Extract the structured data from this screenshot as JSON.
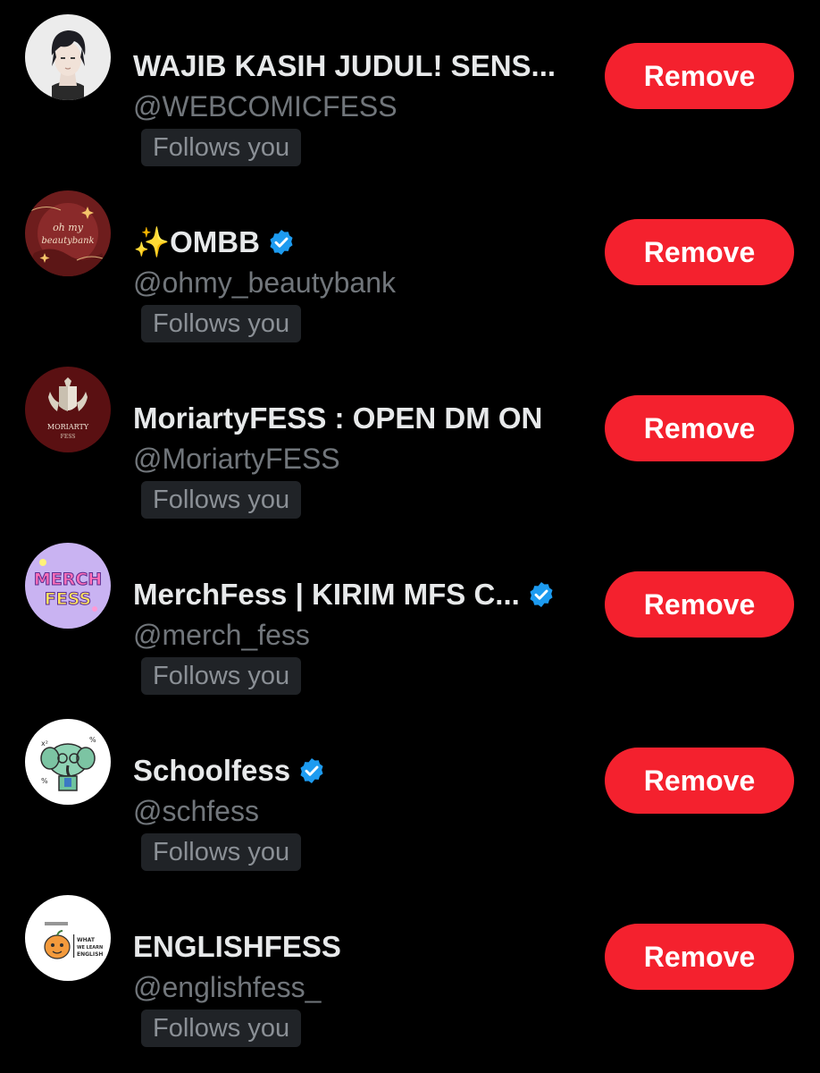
{
  "colors": {
    "background": "#000000",
    "remove_button": "#f4212e",
    "verified_badge": "#1d9bf0",
    "handle_text": "#71767b",
    "follows_chip": "#202327"
  },
  "followers": [
    {
      "name": "WAJIB KASIH JUDUL! SENS...",
      "handle": "@WEBCOMICFESS",
      "follows_label": "Follows you",
      "verified": false,
      "remove_label": "Remove",
      "avatar_icon": "anime-boy-avatar-icon"
    },
    {
      "name": "✨OMBB",
      "handle": "@ohmy_beautybank",
      "follows_label": "Follows you",
      "verified": true,
      "remove_label": "Remove",
      "avatar_icon": "oh-my-beautybank-logo-icon",
      "avatar_text": [
        "oh my",
        "beautybank"
      ]
    },
    {
      "name": "MoriartyFESS : OPEN DM ON",
      "handle": "@MoriartyFESS",
      "follows_label": "Follows you",
      "verified": false,
      "remove_label": "Remove",
      "avatar_icon": "moriarty-crest-icon",
      "avatar_text": [
        "MORIARTY",
        "FESS"
      ]
    },
    {
      "name": "MerchFess | KIRIM MFS C...",
      "handle": "@merch_fess",
      "follows_label": "Follows you",
      "verified": true,
      "remove_label": "Remove",
      "avatar_icon": "merchfess-logo-icon",
      "avatar_text": [
        "MERCH",
        "FESS"
      ]
    },
    {
      "name": "Schoolfess",
      "handle": "@schfess",
      "follows_label": "Follows you",
      "verified": true,
      "remove_label": "Remove",
      "avatar_icon": "elephant-student-icon"
    },
    {
      "name": "ENGLISHFESS",
      "handle": "@englishfess_",
      "follows_label": "Follows you",
      "verified": false,
      "remove_label": "Remove",
      "avatar_icon": "englishfess-pumpkin-icon",
      "avatar_text": [
        "WHAT",
        "WE LEARN",
        "ENGLISH"
      ]
    }
  ]
}
